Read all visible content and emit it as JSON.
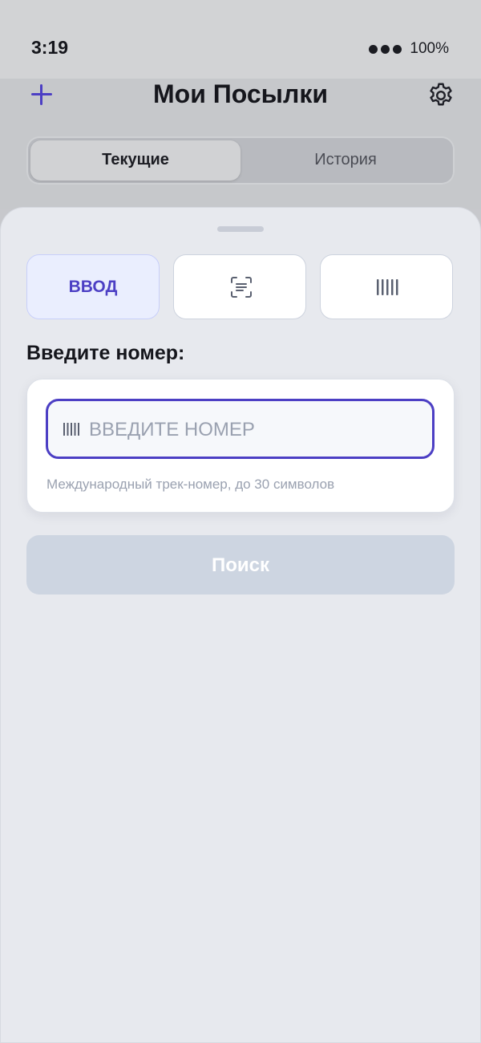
{
  "status_bar": {
    "time": "3:19",
    "battery": "100%"
  },
  "header": {
    "title": "Мои Посылки",
    "add_icon": "plus-icon",
    "settings_icon": "gear-icon"
  },
  "tabs": {
    "current": "Текущие",
    "history": "История",
    "selected": "current"
  },
  "input_modes": [
    {
      "label": "ВВОД",
      "selected": true
    },
    {
      "icon": "scan-text-icon",
      "selected": false
    },
    {
      "icon": "barcode-icon",
      "selected": false
    }
  ],
  "form": {
    "section_label": "Введите номер:",
    "tracking_value": "",
    "tracking_placeholder": "ВВЕДИТЕ НОМЕР",
    "hint": "Международный трек-номер, до 30 символов"
  },
  "search_button": {
    "label": "Поиск",
    "enabled": false
  },
  "colors": {
    "accent": "#4c3fc4",
    "sheet": "#e7e9ee",
    "disabled_button": "#cdd5e1"
  }
}
